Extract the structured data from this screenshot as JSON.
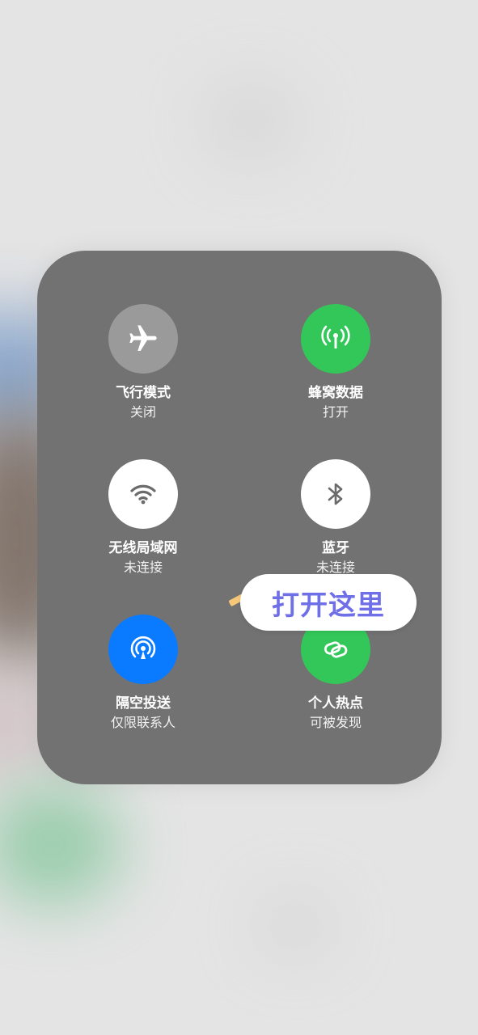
{
  "panel": {
    "tiles": [
      {
        "key": "airplane",
        "title": "飞行模式",
        "status": "关闭",
        "icon": "airplane-icon",
        "color": "#9a9a9a"
      },
      {
        "key": "cellular",
        "title": "蜂窝数据",
        "status": "打开",
        "icon": "cellular-antenna-icon",
        "color": "#33c759"
      },
      {
        "key": "wifi",
        "title": "无线局域网",
        "status": "未连接",
        "icon": "wifi-icon",
        "color": "#ffffff"
      },
      {
        "key": "bluetooth",
        "title": "蓝牙",
        "status": "未连接",
        "icon": "bluetooth-icon",
        "color": "#ffffff"
      },
      {
        "key": "airdrop",
        "title": "隔空投送",
        "status": "仅限联系人",
        "icon": "airdrop-icon",
        "color": "#0a7aff"
      },
      {
        "key": "hotspot",
        "title": "个人热点",
        "status": "可被发现",
        "icon": "hotspot-link-icon",
        "color": "#33c759"
      }
    ]
  },
  "annotation": {
    "text": "打开这里",
    "color": "#6f6fe8"
  }
}
